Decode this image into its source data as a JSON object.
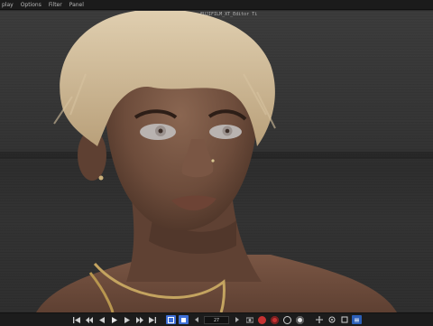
{
  "menubar": {
    "items": [
      "play",
      "Options",
      "Filter",
      "Panel"
    ]
  },
  "viewport": {
    "camera_label": "FUJIFILM_XT_Editor Ti"
  },
  "timeline": {
    "current_frame": "27",
    "colors": {
      "blue": "#3f6fd6",
      "red": "#c63232",
      "accent": "#2c5fb8"
    }
  },
  "icons": {
    "transport": [
      "first-frame-icon",
      "prev-key-icon",
      "prev-frame-icon",
      "play-icon",
      "next-frame-icon",
      "next-key-icon",
      "last-frame-icon"
    ],
    "record": [
      "record-icon",
      "autokey-icon",
      "keyframe-icon"
    ],
    "modes": [
      "move-icon",
      "rotate-icon",
      "scale-icon",
      "timeline-icon"
    ]
  }
}
